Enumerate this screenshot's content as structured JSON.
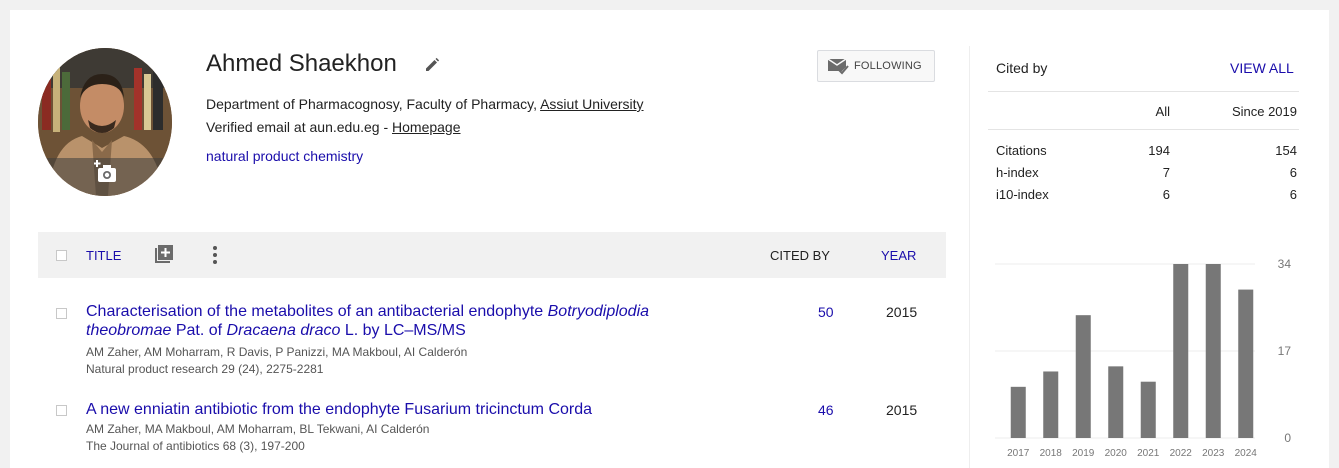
{
  "profile": {
    "name": "Ahmed Shaekhon",
    "affiliation_prefix": "Department of Pharmacognosy, Faculty of Pharmacy, ",
    "affiliation_link": "Assiut University",
    "email_text": "Verified email at aun.edu.eg - ",
    "homepage_label": "Homepage",
    "interest": "natural product chemistry",
    "follow_label": "FOLLOWING"
  },
  "table": {
    "header": {
      "title": "TITLE",
      "cited_by": "CITED BY",
      "year": "YEAR"
    },
    "articles": [
      {
        "title_parts": [
          "Characterisation of the metabolites of an antibacterial endophyte ",
          "Botryodiplodia theobromae",
          " Pat. of ",
          "Dracaena draco",
          " L. by LC–MS/MS"
        ],
        "authors": "AM Zaher, AM Moharram, R Davis, P Panizzi, MA Makboul, AI Calderón",
        "venue": "Natural product research 29 (24), 2275-2281",
        "cited_by": "50",
        "year": "2015"
      },
      {
        "title": "A new enniatin antibiotic from the endophyte Fusarium tricinctum Corda",
        "authors": "AM Zaher, MA Makboul, AM Moharram, BL Tekwani, AI Calderón",
        "venue": "The Journal of antibiotics 68 (3), 197-200",
        "cited_by": "46",
        "year": "2015"
      }
    ]
  },
  "sidebar": {
    "title": "Cited by",
    "view_all": "VIEW ALL",
    "columns": [
      "All",
      "Since 2019"
    ],
    "rows": [
      {
        "label": "Citations",
        "all": "194",
        "since": "154"
      },
      {
        "label": "h-index",
        "all": "7",
        "since": "6"
      },
      {
        "label": "i10-index",
        "all": "6",
        "since": "6"
      }
    ]
  },
  "chart_data": {
    "type": "bar",
    "categories": [
      "2017",
      "2018",
      "2019",
      "2020",
      "2021",
      "2022",
      "2023",
      "2024"
    ],
    "values": [
      10,
      13,
      24,
      14,
      11,
      34,
      34,
      29
    ],
    "ylim": [
      0,
      34
    ],
    "yticks": [
      "34",
      "17",
      "0"
    ],
    "bar_color": "#777777",
    "grid": true
  },
  "colors": {
    "link": "#1a0dab",
    "header_bg": "#f1f1f1",
    "bar": "#777777"
  }
}
